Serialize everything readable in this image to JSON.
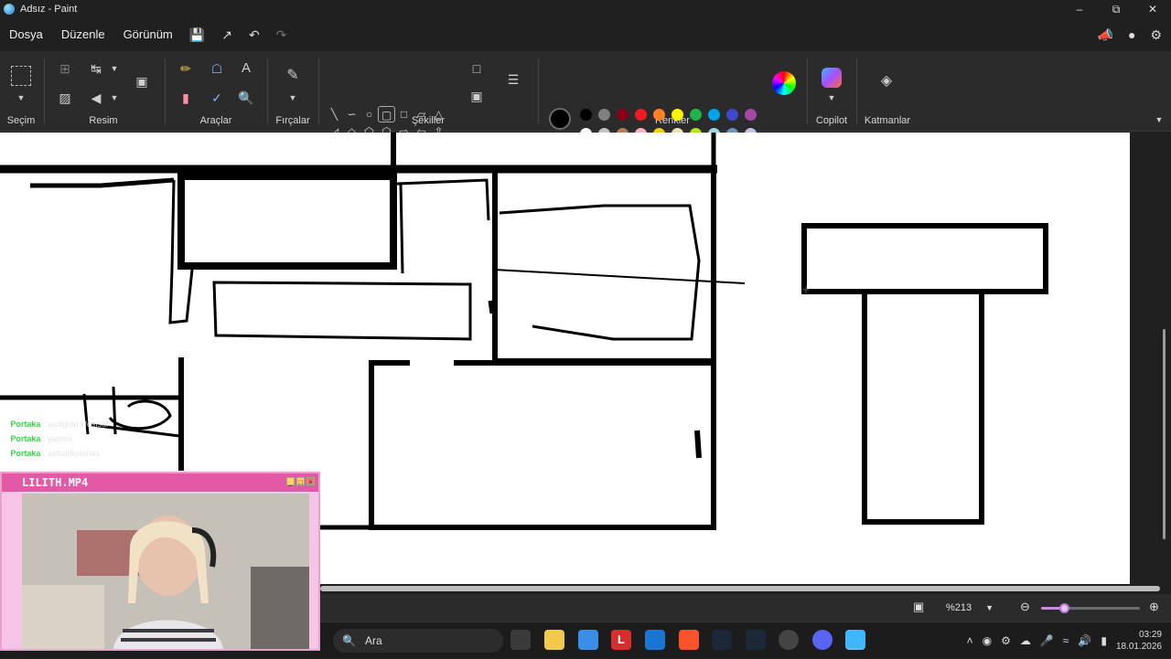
{
  "window": {
    "title": "Adsız - Paint",
    "minimize_icon": "minimize-icon",
    "maximize_icon": "restore-icon",
    "close_icon": "close-icon"
  },
  "menu": {
    "file": "Dosya",
    "edit": "Düzenle",
    "view": "Görünüm"
  },
  "ribbon": {
    "groups": {
      "selection": "Seçim",
      "image": "Resim",
      "tools": "Araçlar",
      "brushes": "Fırçalar",
      "shapes": "Şekiller",
      "colors": "Renkler",
      "copilot": "Copilot",
      "layers": "Katmanlar"
    },
    "current_colors": {
      "primary": "#000000",
      "secondary": "#ffffff"
    },
    "palette_row1": [
      "#000000",
      "#7f7f7f",
      "#880015",
      "#ed1c24",
      "#ff7f27",
      "#fff200",
      "#22b14c",
      "#00a2e8",
      "#3f48cc",
      "#a349a4"
    ],
    "palette_row2": [
      "#ffffff",
      "#c3c3c3",
      "#b97a57",
      "#ffaec9",
      "#ffc90e",
      "#efe4b0",
      "#b5e61d",
      "#99d9ea",
      "#7092be",
      "#c8bfe7"
    ]
  },
  "chat": [
    {
      "user": "Portaka",
      "msg": "asdiguiu.kfoslsdf"
    },
    {
      "user": "Portaka",
      "msg": "yapma"
    },
    {
      "user": "Portaka",
      "msg": "asfsadkjasnas"
    }
  ],
  "video": {
    "title": "LILITH.MP4"
  },
  "status": {
    "zoom": "%213",
    "zoom_level_percent": 213
  },
  "taskbar": {
    "search_placeholder": "Ara",
    "time": "03:29",
    "date": "18.01.2026"
  }
}
